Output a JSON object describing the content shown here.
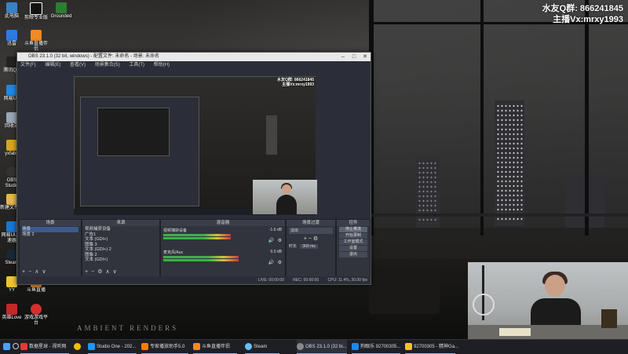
{
  "overlay": {
    "line1": "水友Q群: 866241845",
    "line2": "主播Vx:mrxy1993"
  },
  "watermark": "AMBIENT RENDERS",
  "desktop_icons": [
    {
      "label": "此电脑",
      "icon": "computer-icon",
      "color": "#3b82c4"
    },
    {
      "label": "剪映专业版",
      "icon": "capcut-icon",
      "color": "#111111"
    },
    {
      "label": "Grounded",
      "icon": "grounded-icon",
      "color": "#2e7d32"
    },
    {
      "label": "迅雷",
      "icon": "thunder-icon",
      "color": "#2a7be4"
    },
    {
      "label": "斗鱼直播伴侣",
      "icon": "douyu-icon",
      "color": "#f08a24"
    },
    {
      "label": "腾讯QQ",
      "icon": "qq-icon",
      "color": "#222222"
    },
    {
      "label": "网易UU",
      "icon": "uu-icon",
      "color": "#1e88e5"
    },
    {
      "label": "回收站",
      "icon": "recycle-bin-icon",
      "color": "#9aa7b5"
    },
    {
      "label": "yxfabu",
      "icon": "file-icon",
      "color": "#d9a520"
    },
    {
      "label": "OBS Studio",
      "icon": "obs-icon",
      "color": "#333333"
    },
    {
      "label": "新建文件夹",
      "icon": "folder-icon",
      "color": "#e6b84a"
    },
    {
      "label": "网易UU加速器",
      "icon": "uu-accelerator-icon",
      "color": "#1976d2"
    },
    {
      "label": "Steam",
      "icon": "steam-icon",
      "color": "#1b2838"
    },
    {
      "label": "YY",
      "icon": "yy-icon",
      "color": "#f4c430"
    },
    {
      "label": "斗鱼直播",
      "icon": "douyu-live-icon",
      "color": "#f08a24"
    },
    {
      "label": "英雄Love",
      "icon": "game-icon",
      "color": "#c62828"
    },
    {
      "label": "游戏游戏平台",
      "icon": "game-platform-icon",
      "color": "#d32f2f"
    }
  ],
  "obs": {
    "title": "OBS 23.1.0 (32 bit, windows) - 配置文件: 未命名 - 场景: 未命名",
    "menu": [
      "文件(F)",
      "编辑(E)",
      "查看(V)",
      "场景集合(S)",
      "工具(T)",
      "帮助(H)"
    ],
    "docks": {
      "scenes": {
        "title": "场景",
        "items": [
          "场景",
          "场景 2"
        ]
      },
      "sources": {
        "title": "来源",
        "items": [
          "视频捕获设备",
          "广告1",
          "文本 (GDI+)",
          "图像 3",
          "文本 (GDI+) 2",
          "图像 2",
          "文本 (GDI+)"
        ]
      },
      "mixer": {
        "title": "混音器",
        "channels": [
          {
            "name": "视频捕获设备",
            "db": "-1.6 dB",
            "level": 0.72
          },
          {
            "name": "麦克风/Aux",
            "db": "0.0 dB",
            "level": 0.8
          }
        ]
      },
      "transitions": {
        "title": "场景过渡",
        "type": "淡出",
        "duration_label": "时长",
        "duration": "300 ms"
      },
      "controls": {
        "title": "控件",
        "buttons": [
          "停止推流",
          "开始录制",
          "工作室模式",
          "设置",
          "退出"
        ]
      }
    },
    "status": {
      "live": "LIVE: 00:00:00",
      "rec": "REC: 00:00:00",
      "cpu": "CPU: 11.4%, 30.00 fps"
    }
  },
  "taskbar": {
    "items": [
      {
        "label": "",
        "icon": "windows-start-icon",
        "color": "#4aa3ff"
      },
      {
        "label": "",
        "icon": "search-icon",
        "color": "#cccccc"
      },
      {
        "label": "数据星球 - 视听网",
        "icon": "browser-icon",
        "color": "#e53935"
      },
      {
        "label": "",
        "icon": "chrome-icon",
        "color": "#fbbc05"
      },
      {
        "label": "Studio One - 202...",
        "icon": "studio-one-icon",
        "color": "#2196f3"
      },
      {
        "label": "专家播放助手5.0",
        "icon": "player-icon",
        "color": "#f57c00"
      },
      {
        "label": "斗鱼直播伴侣",
        "icon": "douyu-icon",
        "color": "#f08a24"
      },
      {
        "label": "Steam",
        "icon": "steam-icon",
        "color": "#66c0f4"
      },
      {
        "label": "OBS 23.1.0 (32 bi...",
        "icon": "obs-icon",
        "color": "#888888"
      },
      {
        "label": "狗眼乐 92700305...",
        "icon": "chat-icon",
        "color": "#1e88e5"
      },
      {
        "label": "92700305 - 精神Ga...",
        "icon": "chat-icon",
        "color": "#fbc02d"
      }
    ]
  }
}
